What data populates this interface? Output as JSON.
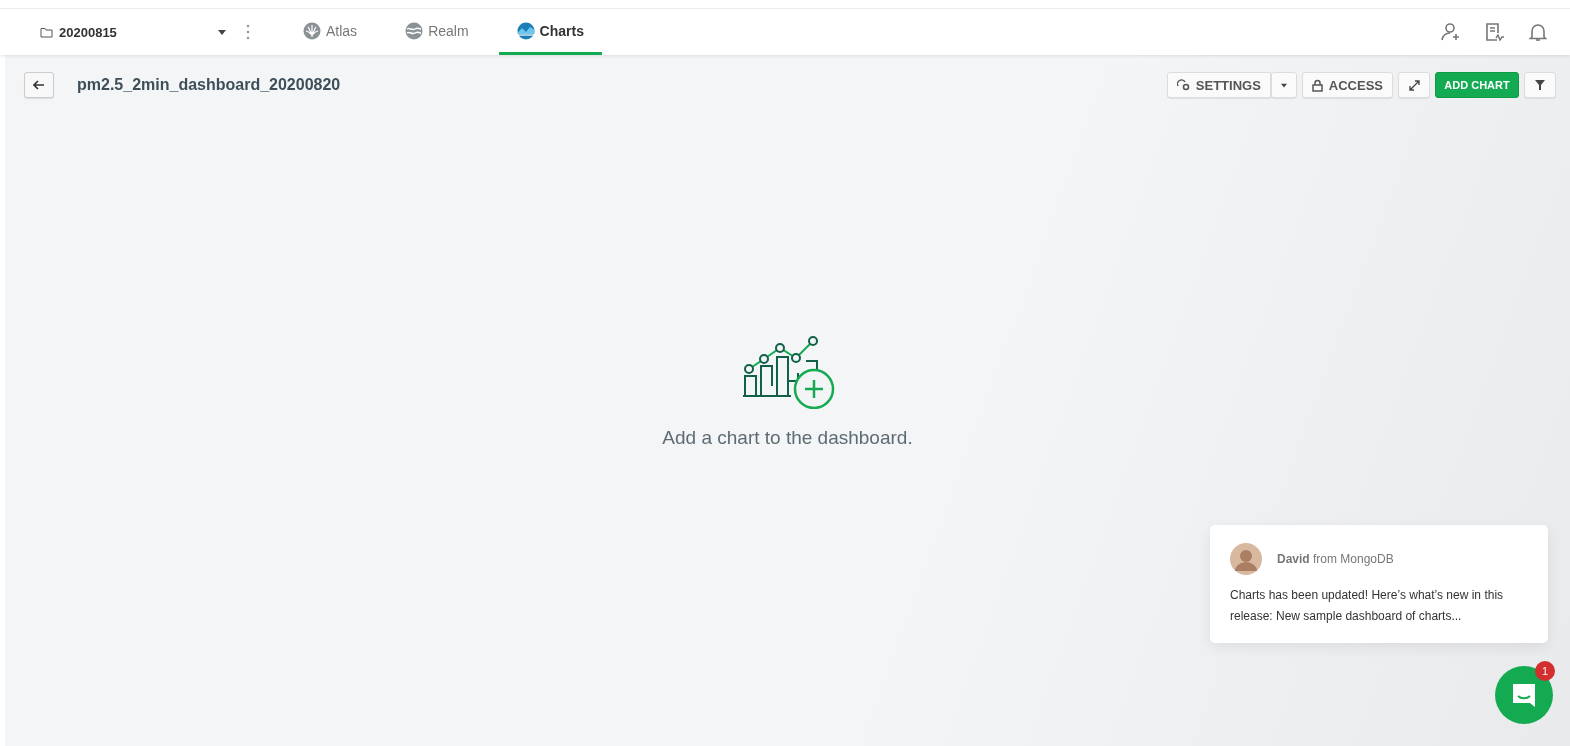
{
  "project": {
    "name": "20200815"
  },
  "tabs": [
    {
      "label": "Atlas",
      "kind": "atlas",
      "selected": false
    },
    {
      "label": "Realm",
      "kind": "realm",
      "selected": false
    },
    {
      "label": "Charts",
      "kind": "charts",
      "selected": true
    }
  ],
  "dashboard": {
    "title": "pm2.5_2min_dashboard_20200820"
  },
  "toolbar": {
    "settings": "SETTINGS",
    "access": "ACCESS",
    "add_chart": "ADD CHART"
  },
  "empty_state": {
    "message": "Add a chart to the dashboard."
  },
  "chat": {
    "sender": "**David** from MongoDB",
    "message": "Charts has been updated! Here’s what’s new in this release: New sample dashboard of charts...",
    "unread": "1"
  }
}
